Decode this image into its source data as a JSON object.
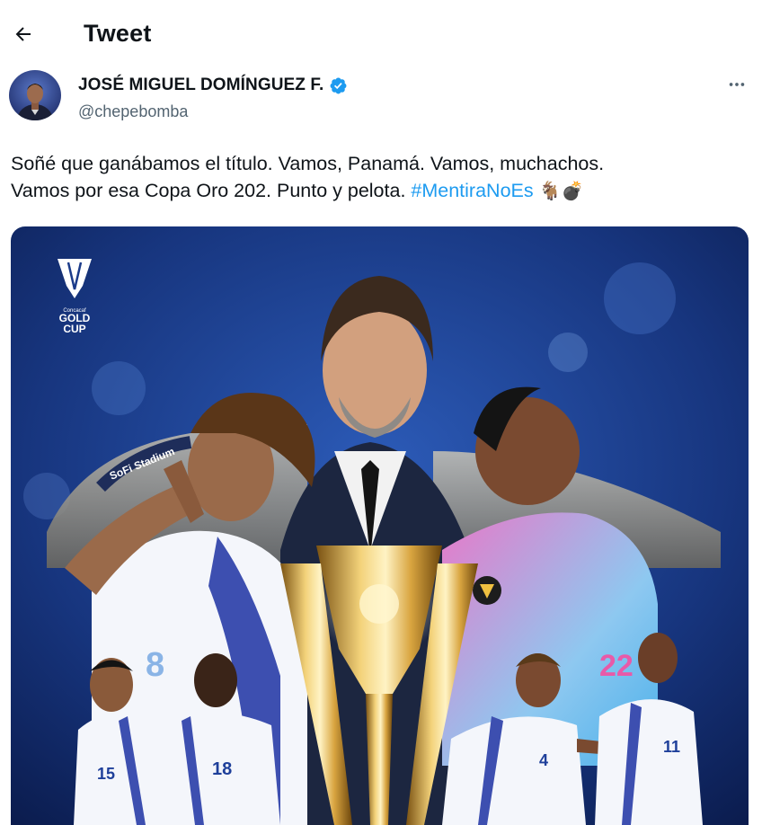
{
  "header": {
    "back_icon": "arrow-left-icon",
    "title": "Tweet"
  },
  "author": {
    "display_name": "JOSÉ MIGUEL DOMÍNGUEZ F.",
    "handle": "@chepebomba",
    "verified": true,
    "verified_color": "#1d9bf0",
    "more_icon": "more-horizontal-icon"
  },
  "tweet": {
    "line1": "Soñé que ganábamos el título. Vamos, Panamá. Vamos, muchachos.",
    "line2_prefix": "Vamos por esa Copa Oro 202. Punto y pelota. ",
    "hashtag": "#MentiraNoEs",
    "emojis": "🐐💣"
  },
  "media": {
    "logo_top": "Concacaf",
    "logo_gold": "GOLD",
    "logo_cup": "CUP",
    "stadium_sign": "SoFi Stadium",
    "jersey_numbers": [
      "8",
      "22",
      "15",
      "18",
      "4",
      "11"
    ]
  },
  "colors": {
    "link": "#1d9bf0",
    "secondary_text": "#536471",
    "primary_text": "#0f1419"
  }
}
